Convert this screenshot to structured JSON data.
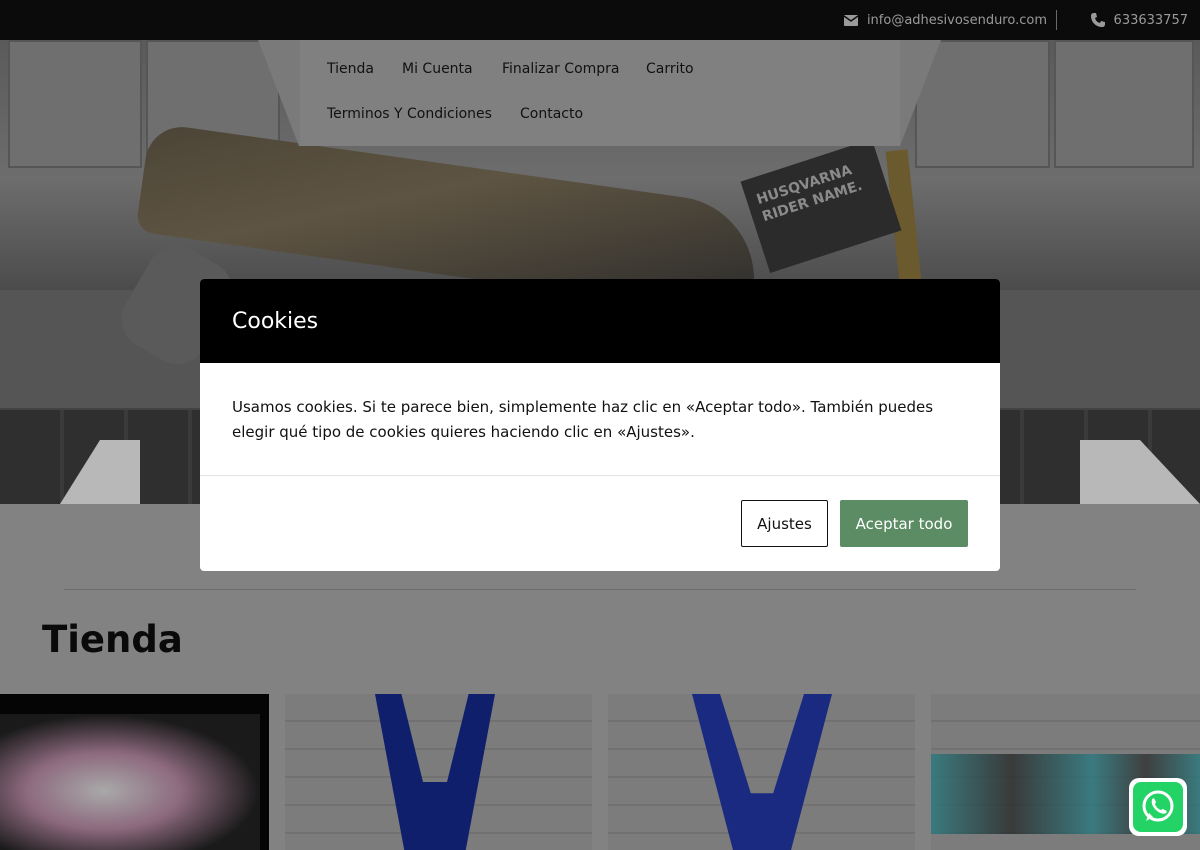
{
  "topbar": {
    "email": "info@adhesivosenduro.com",
    "phone": "633633757"
  },
  "nav": {
    "items": [
      {
        "label": "Tienda"
      },
      {
        "label": "Mi Cuenta"
      },
      {
        "label": "Finalizar Compra"
      },
      {
        "label": "Carrito"
      },
      {
        "label": "Terminos Y Condiciones"
      },
      {
        "label": "Contacto"
      }
    ]
  },
  "hero": {
    "plate_text": "HUSQVARNA RIDER NAME."
  },
  "shop": {
    "title": "Tienda"
  },
  "cookie_modal": {
    "title": "Cookies",
    "text": "Usamos cookies. Si te parece bien, simplemente haz clic en «Aceptar todo». También puedes elegir qué tipo de cookies quieres haciendo clic en «Ajustes».",
    "settings_label": "Ajustes",
    "accept_label": "Aceptar todo"
  },
  "colors": {
    "accept_button": "#5b8c64",
    "modal_header": "#000000",
    "whatsapp": "#23d366"
  },
  "icons": {
    "email": "envelope-icon",
    "phone": "phone-icon",
    "whatsapp": "whatsapp-icon"
  }
}
